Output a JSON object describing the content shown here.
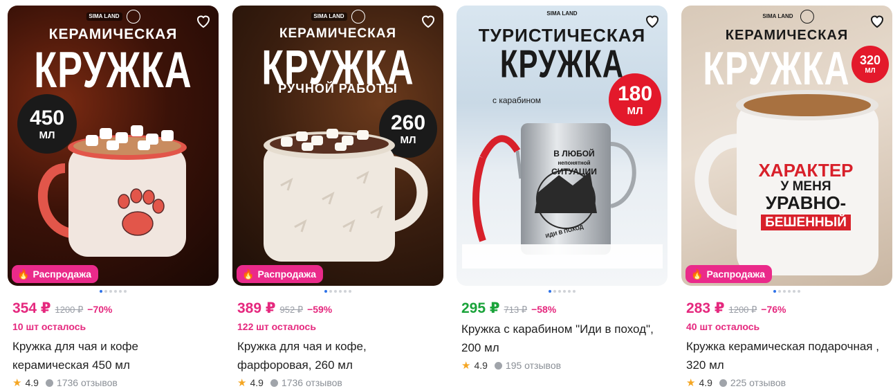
{
  "products": [
    {
      "brand": "SIMA LAND",
      "image_text_top": "КЕРАМИЧЕСКАЯ",
      "image_text_big": "КРУЖКА",
      "image_text_sub": "",
      "volume_num": "450",
      "volume_unit": "МЛ",
      "sale_label": "Распродажа",
      "price": "354 ₽",
      "price_color": "#e5287e",
      "old_price": "1200 ₽",
      "discount": "−70%",
      "stock": "10 шт осталось",
      "title": "Кружка для чая и кофе керамическая 450 мл",
      "rating": "4.9",
      "reviews": "1736 отзывов"
    },
    {
      "brand": "SIMA LAND",
      "image_text_top": "КЕРАМИЧЕСКАЯ",
      "image_text_big": "КРУЖКА",
      "image_text_sub": "РУЧНОЙ РАБОТЫ",
      "volume_num": "260",
      "volume_unit": "МЛ",
      "sale_label": "Распродажа",
      "price": "389 ₽",
      "price_color": "#e5287e",
      "old_price": "952 ₽",
      "discount": "−59%",
      "stock": "122 шт осталось",
      "title": "Кружка для чая и кофе, фарфоровая, 260 мл",
      "rating": "4.9",
      "reviews": "1736 отзывов"
    },
    {
      "brand": "SIMA LAND",
      "image_text_top": "ТУРИСТИЧЕСКАЯ",
      "image_text_big": "КРУЖКА",
      "image_text_sub": "с карабином",
      "mug_print": [
        "В ЛЮБОЙ",
        "непонятной",
        "СИТУАЦИИ",
        "ИДИ В ПОХОД"
      ],
      "volume_num": "180",
      "volume_unit": "МЛ",
      "sale_label": "",
      "price": "295 ₽",
      "price_color": "#1aa33a",
      "old_price": "713 ₽",
      "discount": "−58%",
      "stock": "",
      "title": "Кружка с карабином \"Иди в поход\", 200 мл",
      "rating": "4.9",
      "reviews": "195 отзывов"
    },
    {
      "brand": "SIMA LAND",
      "image_text_top": "КЕРАМИЧЕСКАЯ",
      "image_text_big": "КРУЖКА",
      "image_text_sub": "",
      "mug_print": [
        "ХАРАКТЕР",
        "У МЕНЯ",
        "УРАВНО-",
        "БЕШЕННЫЙ"
      ],
      "volume_num": "320",
      "volume_unit": "МЛ",
      "sale_label": "Распродажа",
      "price": "283 ₽",
      "price_color": "#e5287e",
      "old_price": "1200 ₽",
      "discount": "−76%",
      "stock": "40 шт осталось",
      "title": "Кружка керамическая подарочная , 320 мл",
      "rating": "4.9",
      "reviews": "225 отзывов"
    }
  ]
}
